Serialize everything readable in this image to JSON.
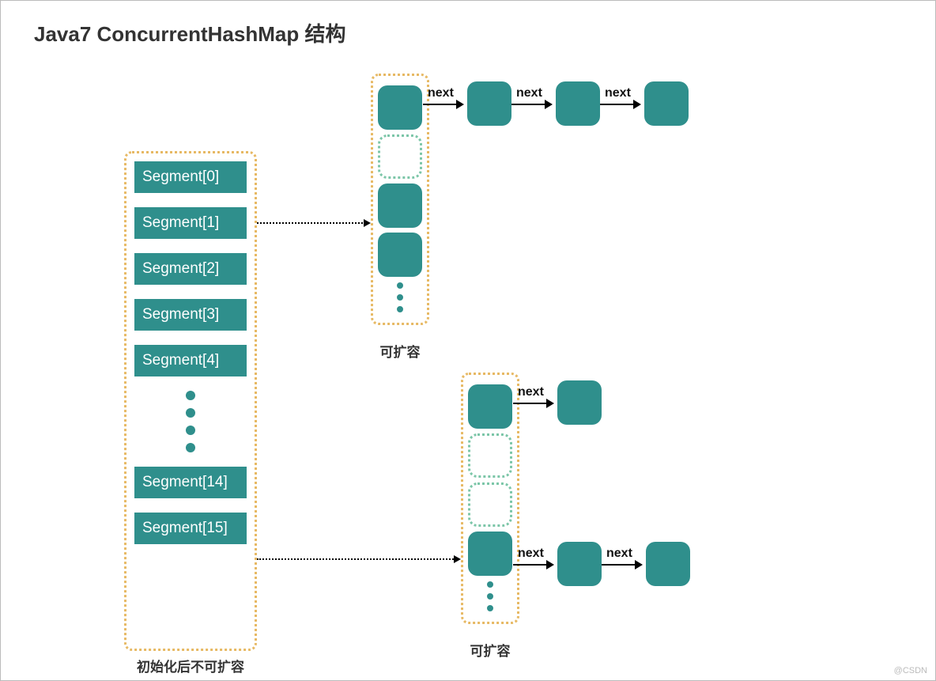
{
  "title": "Java7 ConcurrentHashMap 结构",
  "colors": {
    "node_fill": "#2f8f8c",
    "dashed_border": "#e7b964",
    "empty_slot_border": "#7cc6a8"
  },
  "segment_array": {
    "caption": "初始化后不可扩容",
    "items": [
      "Segment[0]",
      "Segment[1]",
      "Segment[2]",
      "Segment[3]",
      "Segment[4]",
      "Segment[14]",
      "Segment[15]"
    ],
    "ellipsis_after_index": 4
  },
  "bucket_top": {
    "caption": "可扩容",
    "slots": [
      {
        "type": "node",
        "chain_next_labels": [
          "next",
          "next",
          "next"
        ]
      },
      {
        "type": "empty"
      },
      {
        "type": "node"
      },
      {
        "type": "node"
      },
      {
        "type": "ellipsis"
      }
    ],
    "linked_from_segment_index": 1
  },
  "bucket_bottom": {
    "caption": "可扩容",
    "slots": [
      {
        "type": "node",
        "chain_next_labels": [
          "next"
        ]
      },
      {
        "type": "empty"
      },
      {
        "type": "empty"
      },
      {
        "type": "node",
        "chain_next_labels": [
          "next",
          "next"
        ]
      },
      {
        "type": "ellipsis"
      }
    ],
    "linked_from_segment_index": 5
  },
  "arrow_label": "next",
  "watermark": "@CSDN"
}
